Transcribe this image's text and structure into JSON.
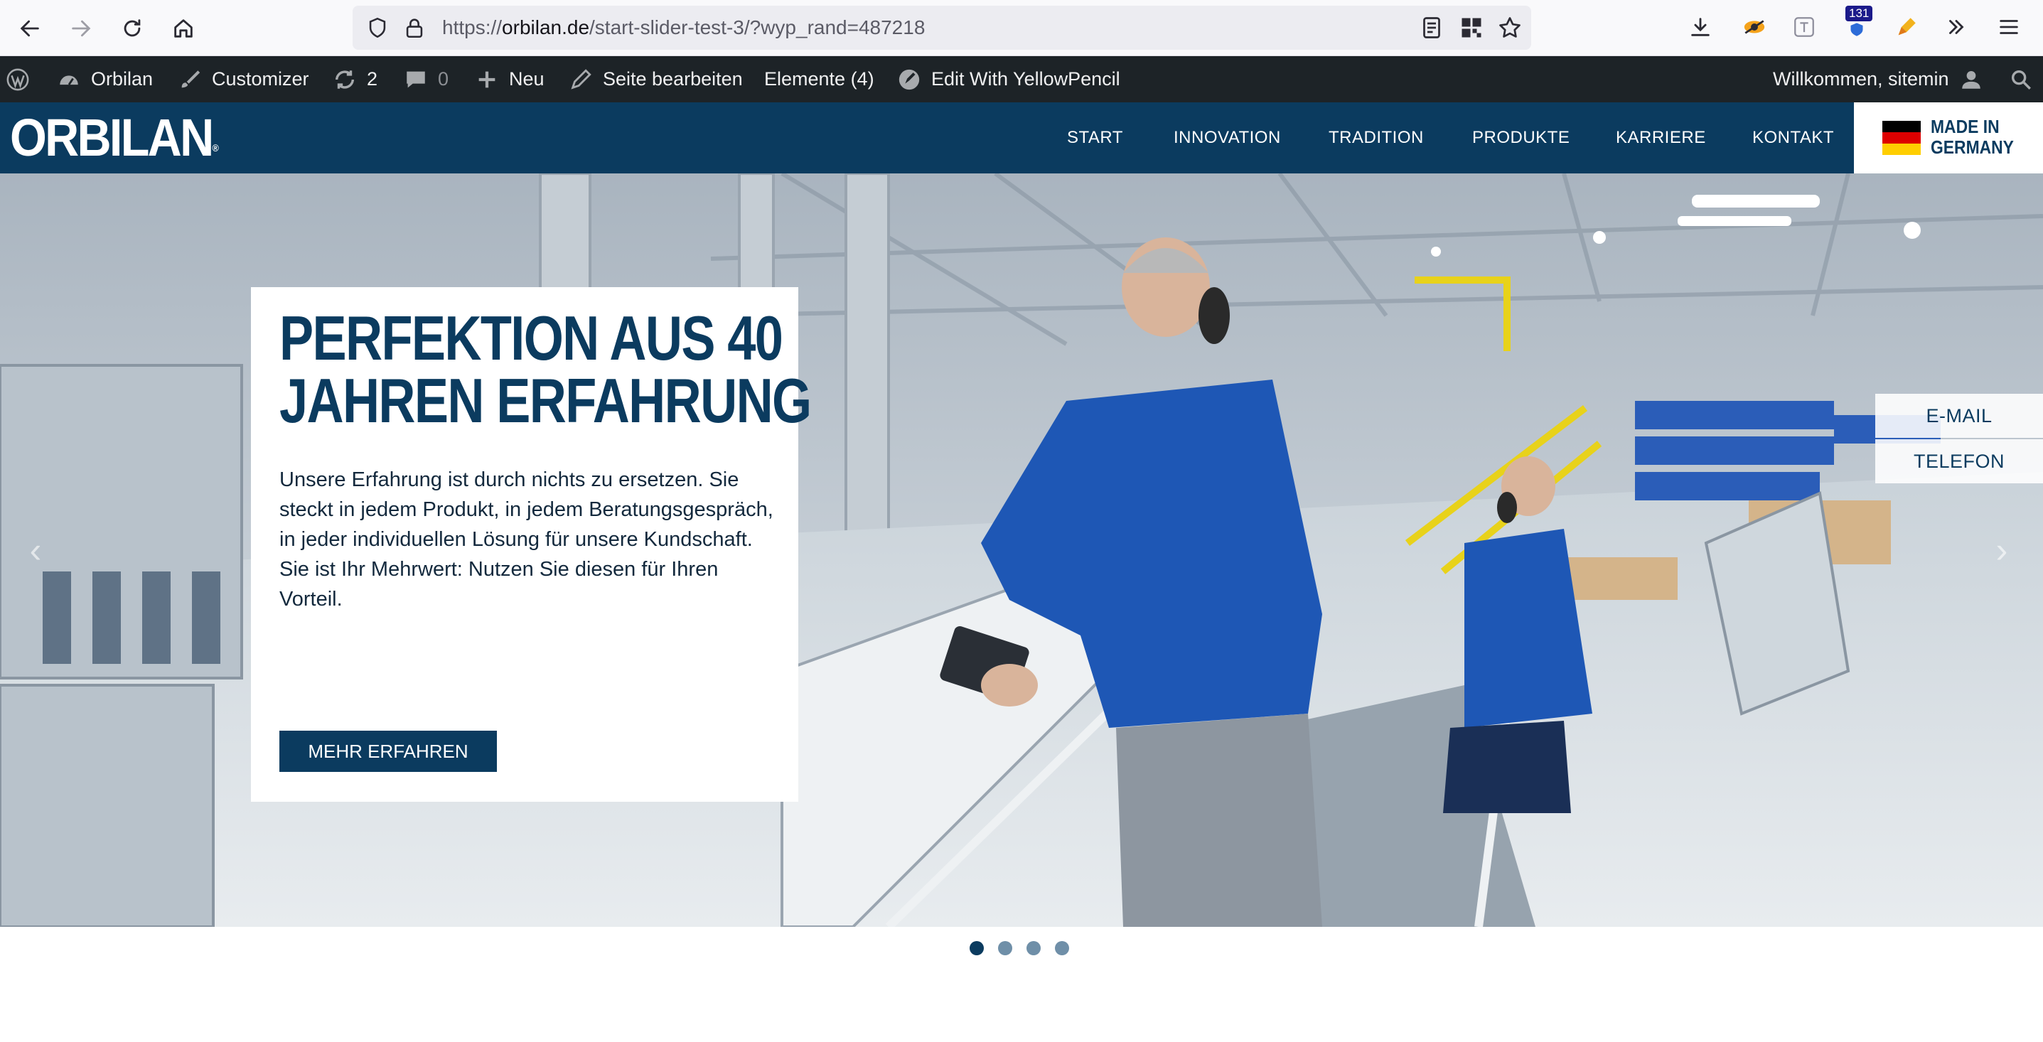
{
  "browser": {
    "url_prefix": "https://",
    "url_domain": "orbilan.de",
    "url_path": "/start-slider-test-3/?wyp_rand=487218",
    "badge_count": "131"
  },
  "wp_admin": {
    "site_name": "Orbilan",
    "customizer": "Customizer",
    "updates_count": "2",
    "comments_count": "0",
    "new_label": "Neu",
    "edit_page": "Seite bearbeiten",
    "elements": "Elemente (4)",
    "yellowpencil": "Edit With YellowPencil",
    "welcome": "Willkommen, sitemin"
  },
  "header": {
    "logo": "ORBILAN",
    "logo_mark": "®",
    "menu": [
      "START",
      "INNOVATION",
      "TRADITION",
      "PRODUKTE",
      "KARRIERE",
      "KONTAKT"
    ],
    "made_in_line1": "MADE IN",
    "made_in_line2": "GERMANY",
    "flag_colors": [
      "#000000",
      "#dd0000",
      "#ffce00"
    ]
  },
  "hero": {
    "title_line1": "PERFEKTION AUS 40",
    "title_line2": "JAHREN ERFAHRUNG",
    "text": "Unsere Erfahrung ist durch nichts zu ersetzen. Sie steckt in jedem Produkt, in jedem Beratungsgespräch, in jeder individuellen Lösung für unsere Kundschaft. Sie ist Ihr Mehrwert: Nutzen Sie diesen für Ihren Vorteil.",
    "button": "MEHR ERFAHREN",
    "side_email": "E-MAIL",
    "side_phone": "TELEFON",
    "prev_arrow": "‹",
    "next_arrow": "›"
  },
  "slider": {
    "dots": 4,
    "active_dot": 1
  },
  "colors": {
    "brand_navy": "#0b3b5f",
    "wp_bar": "#1d2327"
  }
}
